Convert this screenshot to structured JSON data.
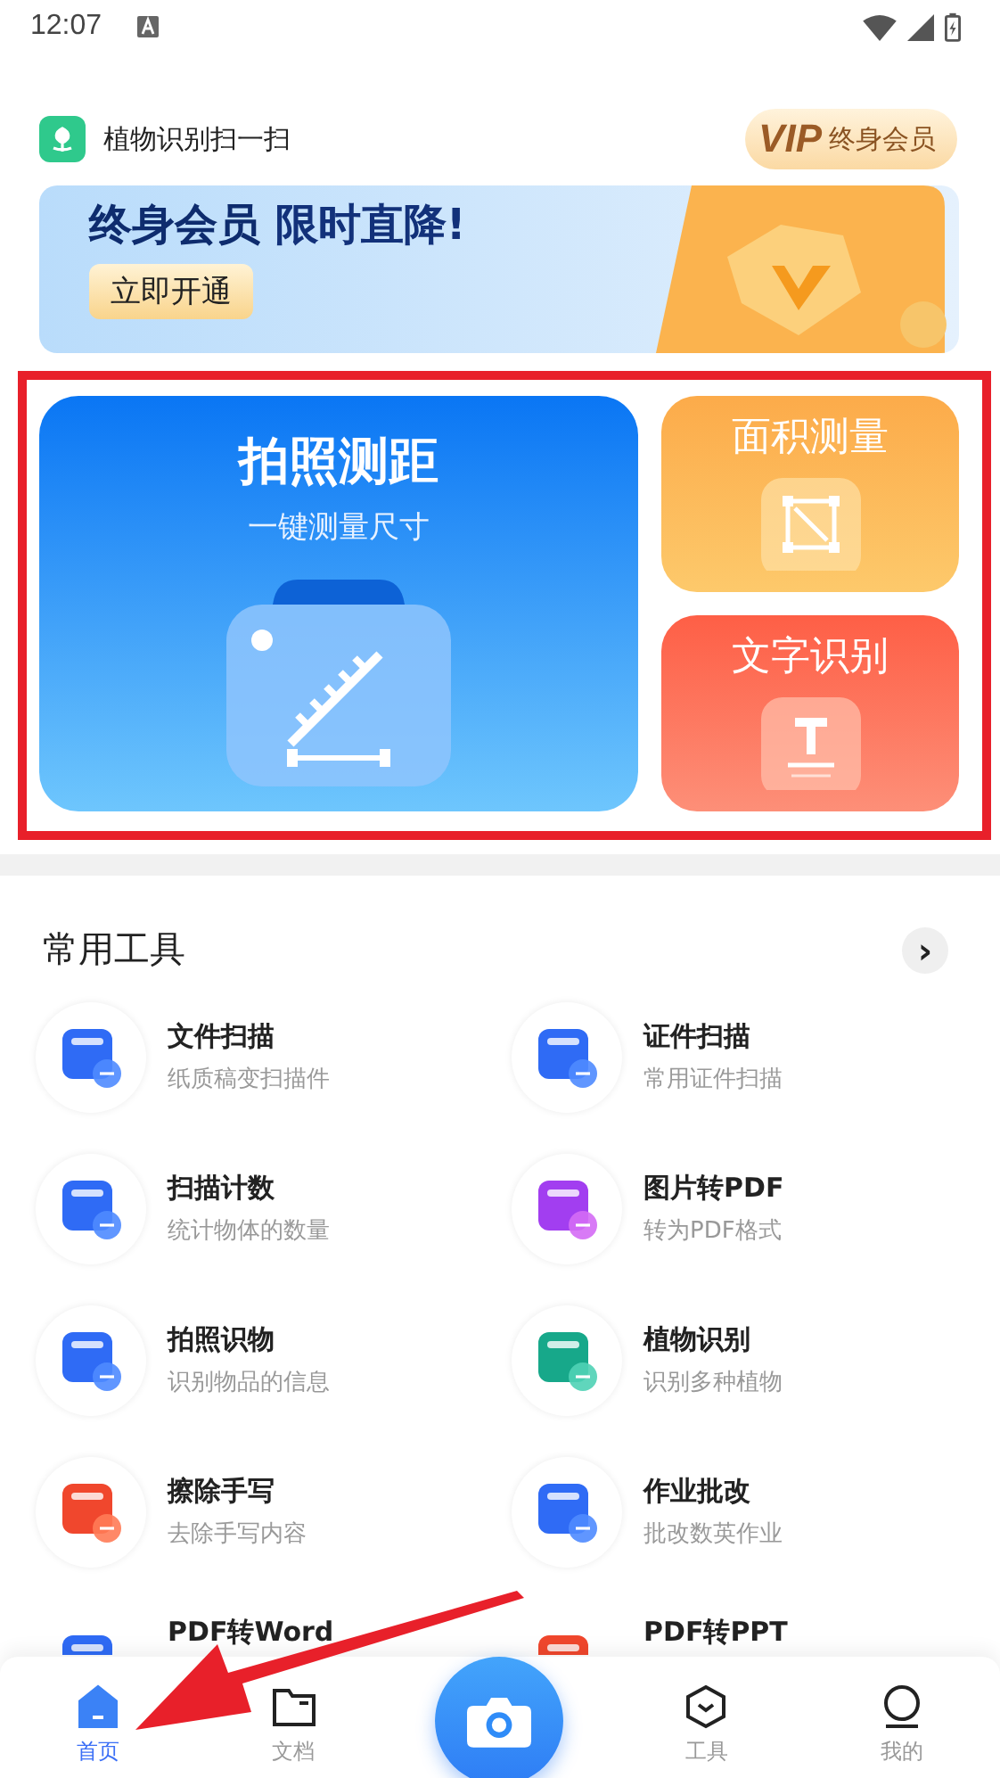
{
  "status_bar": {
    "time": "12:07"
  },
  "header": {
    "app_title": "植物识别扫一扫",
    "vip_mark": "VIP",
    "vip_label": "终身会员"
  },
  "banner": {
    "headline_a": "终身会员",
    "headline_b": "限时直降!",
    "button": "立即开通"
  },
  "features": [
    {
      "kind": "distance",
      "title": "拍照测距",
      "subtitle": "一键测量尺寸"
    },
    {
      "kind": "area",
      "title": "面积测量"
    },
    {
      "kind": "text",
      "title": "文字识别"
    }
  ],
  "tools_section": {
    "title": "常用工具",
    "more": "›"
  },
  "tools": [
    {
      "title": "文件扫描",
      "subtitle": "纸质稿变扫描件"
    },
    {
      "title": "证件扫描",
      "subtitle": "常用证件扫描"
    },
    {
      "title": "扫描计数",
      "subtitle": "统计物体的数量"
    },
    {
      "title": "图片转PDF",
      "subtitle": "转为PDF格式"
    },
    {
      "title": "拍照识物",
      "subtitle": "识别物品的信息"
    },
    {
      "title": "植物识别",
      "subtitle": "识别多种植物"
    },
    {
      "title": "擦除手写",
      "subtitle": "去除手写内容"
    },
    {
      "title": "作业批改",
      "subtitle": "批改数英作业"
    },
    {
      "title": "PDF转Word"
    },
    {
      "title": "PDF转PPT"
    }
  ],
  "bottom_nav": [
    {
      "label": "首页",
      "selected": true
    },
    {
      "label": "文档",
      "selected": false
    },
    {
      "kind": "camera"
    },
    {
      "label": "工具",
      "selected": false
    },
    {
      "label": "我的",
      "selected": false
    }
  ]
}
